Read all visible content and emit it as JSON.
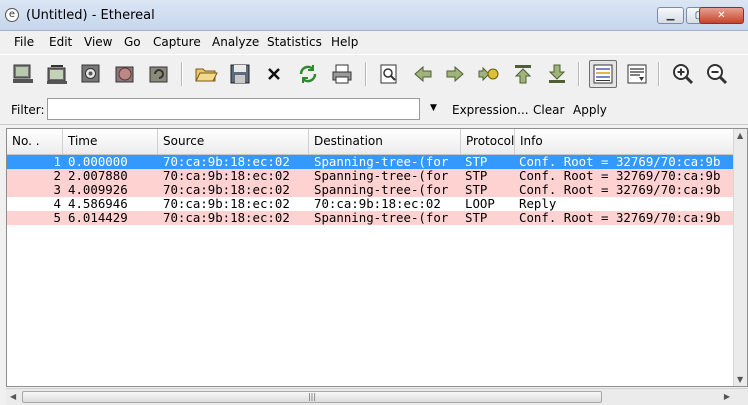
{
  "window": {
    "title": "(Untitled) - Ethereal"
  },
  "menu": [
    "File",
    "Edit",
    "View",
    "Go",
    "Capture",
    "Analyze",
    "Statistics",
    "Help"
  ],
  "toolbar": {
    "icons": [
      "interfaces-icon",
      "capture-options-icon",
      "capture-start-icon",
      "capture-stop-icon",
      "capture-restart-icon",
      "open-file-icon",
      "save-file-icon",
      "close-file-icon",
      "reload-icon",
      "print-icon",
      "find-packet-icon",
      "go-back-icon",
      "go-forward-icon",
      "go-to-packet-icon",
      "go-first-icon",
      "go-last-icon",
      "colorize-icon",
      "auto-scroll-icon",
      "zoom-in-icon",
      "zoom-out-icon"
    ]
  },
  "filter": {
    "label": "Filter:",
    "value": "",
    "expression_label": "Expression...",
    "clear_label": "Clear",
    "apply_label": "Apply"
  },
  "packet_list": {
    "columns": [
      "No. .",
      "Time",
      "Source",
      "Destination",
      "Protocol",
      "Info"
    ],
    "rows": [
      {
        "no": "1",
        "time": "0.000000",
        "source": "70:ca:9b:18:ec:02",
        "destination": "Spanning-tree-(for",
        "protocol": "STP",
        "info": "Conf. Root = 32769/70:ca:9b",
        "style": "selected"
      },
      {
        "no": "2",
        "time": "2.007880",
        "source": "70:ca:9b:18:ec:02",
        "destination": "Spanning-tree-(for",
        "protocol": "STP",
        "info": "Conf. Root = 32769/70:ca:9b",
        "style": "stp"
      },
      {
        "no": "3",
        "time": "4.009926",
        "source": "70:ca:9b:18:ec:02",
        "destination": "Spanning-tree-(for",
        "protocol": "STP",
        "info": "Conf. Root = 32769/70:ca:9b",
        "style": "stp"
      },
      {
        "no": "4",
        "time": "4.586946",
        "source": "70:ca:9b:18:ec:02",
        "destination": "70:ca:9b:18:ec:02",
        "protocol": "LOOP",
        "info": "Reply",
        "style": "plain"
      },
      {
        "no": "5",
        "time": "6.014429",
        "source": "70:ca:9b:18:ec:02",
        "destination": "Spanning-tree-(for",
        "protocol": "STP",
        "info": "Conf. Root = 32769/70:ca:9b",
        "style": "stp"
      }
    ]
  },
  "colors": {
    "selected_bg": "#3399ff",
    "selected_fg": "#ffffff",
    "stp_bg": "#ffd2d2",
    "plain_bg": "#ffffff",
    "text": "#000000"
  }
}
